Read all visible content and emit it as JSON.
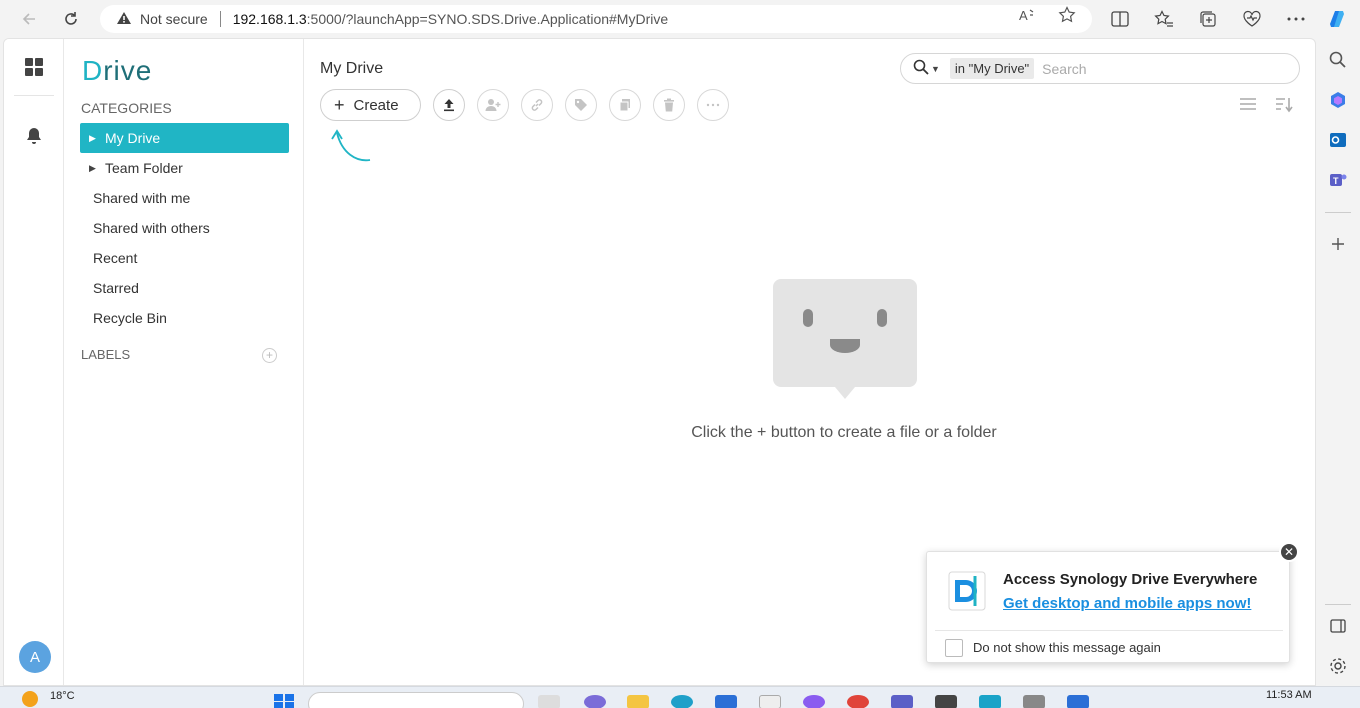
{
  "browser": {
    "security_label": "Not secure",
    "url_host": "192.168.1.3",
    "url_rest": ":5000/?launchApp=SYNO.SDS.Drive.Application#MyDrive"
  },
  "app": {
    "logo_initial": "D",
    "logo_rest": "rive",
    "categories_title": "CATEGORIES",
    "nav": [
      {
        "label": "My Drive",
        "caret": "▶"
      },
      {
        "label": "Team Folder",
        "caret": "▶"
      },
      {
        "label": "Shared with me"
      },
      {
        "label": "Shared with others"
      },
      {
        "label": "Recent"
      },
      {
        "label": "Starred"
      },
      {
        "label": "Recycle Bin"
      }
    ],
    "labels_title": "LABELS",
    "avatar_letter": "A"
  },
  "main": {
    "title": "My Drive",
    "create_label": "Create",
    "search_scope": "in \"My Drive\"",
    "search_placeholder": "Search",
    "empty_message": "Click the + button to create a file or a folder"
  },
  "popup": {
    "title": "Access Synology Drive Everywhere",
    "link": "Get desktop and mobile apps now!",
    "checkbox_label": "Do not show this message again"
  },
  "taskbar": {
    "temperature": "18°C",
    "time": "11:53 AM"
  },
  "colors": {
    "accent": "#20b5c5",
    "link": "#1a8fe0"
  }
}
